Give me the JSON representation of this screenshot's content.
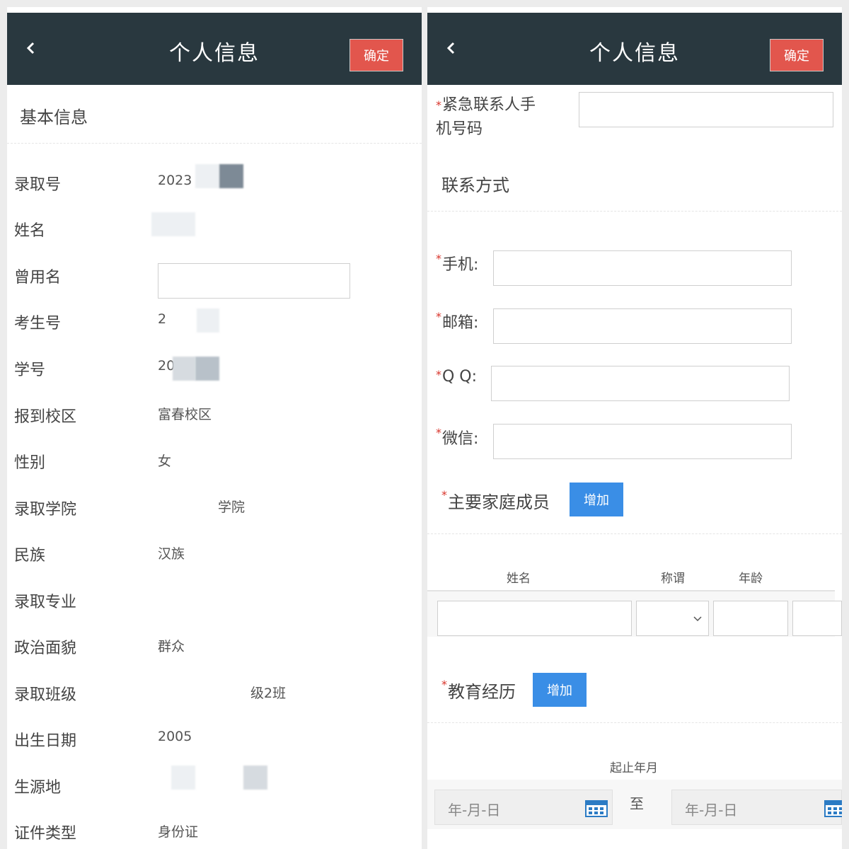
{
  "header": {
    "title": "个人信息",
    "confirm_label": "确定"
  },
  "left": {
    "section_title": "基本信息",
    "fields": [
      {
        "label": "录取号",
        "value": "2023"
      },
      {
        "label": "姓名",
        "value": ""
      },
      {
        "label": "曾用名",
        "value": ""
      },
      {
        "label": "考生号",
        "value": "2"
      },
      {
        "label": "学号",
        "value": "20"
      },
      {
        "label": "报到校区",
        "value": "富春校区"
      },
      {
        "label": "性别",
        "value": "女"
      },
      {
        "label": "录取学院",
        "value": "学院"
      },
      {
        "label": "民族",
        "value": "汉族"
      },
      {
        "label": "录取专业",
        "value": ""
      },
      {
        "label": "政治面貌",
        "value": "群众"
      },
      {
        "label": "录取班级",
        "value": "级2班"
      },
      {
        "label": "出生日期",
        "value": "2005"
      },
      {
        "label": "生源地",
        "value": ""
      },
      {
        "label": "证件类型",
        "value": "身份证"
      }
    ]
  },
  "right": {
    "emergency_label_line1": "紧急联系人手",
    "emergency_label_line2": "机号码",
    "contact_section_title": "联系方式",
    "phone_label": "手机:",
    "email_label": "邮箱:",
    "qq_label": "Q Q:",
    "wechat_label": "微信:",
    "required_mark": "*",
    "family_label": "主要家庭成员",
    "add_label": "增加",
    "family_columns": [
      "姓名",
      "称谓",
      "年龄"
    ],
    "education_label": "教育经历",
    "date_range_label": "起止年月",
    "date_placeholder": "年-月-日",
    "date_separator": "至"
  },
  "colors": {
    "header_bg": "#29383f",
    "confirm_bg": "#e2564d",
    "add_bg": "#3a8ee6",
    "required": "#d9342b"
  },
  "icons": {
    "back": "chevron-left-icon",
    "dropdown": "chevron-down-icon",
    "calendar": "calendar-icon"
  }
}
